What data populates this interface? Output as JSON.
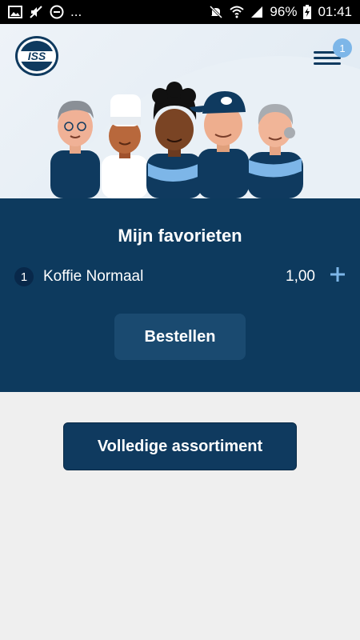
{
  "status_bar": {
    "battery": "96%",
    "time": "01:41",
    "overflow": "..."
  },
  "header": {
    "logo_text": "ISS",
    "menu_badge": "1"
  },
  "favorites": {
    "title": "Mijn favorieten",
    "items": [
      {
        "quantity": "1",
        "name": "Koffie Normaal",
        "price": "1,00"
      }
    ],
    "order_label": "Bestellen"
  },
  "catalog_label": "Volledige assortiment",
  "colors": {
    "navy": "#0d3a5e",
    "button": "#1a4a70",
    "badge": "#7db6e8",
    "background": "#efefef"
  }
}
